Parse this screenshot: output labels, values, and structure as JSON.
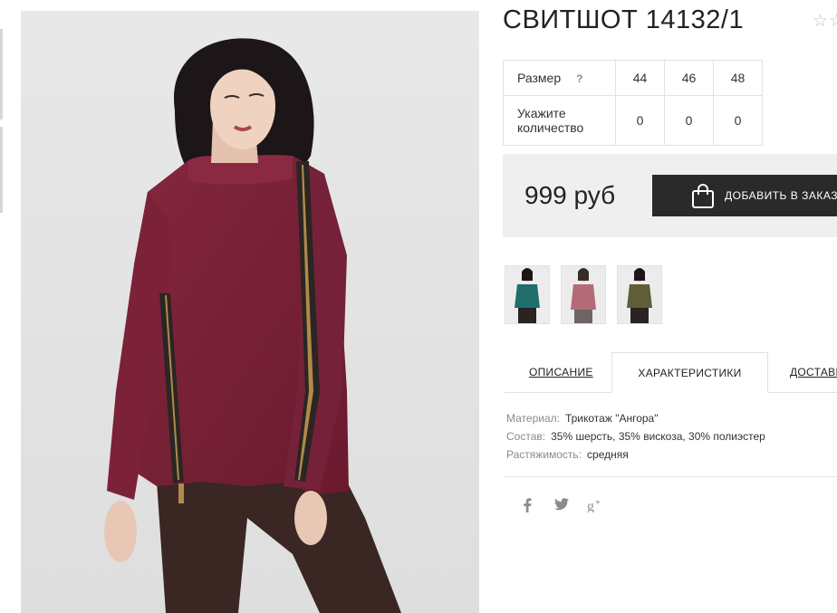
{
  "product": {
    "title": "СВИТШОТ 14132/1",
    "rating_stars": "☆☆"
  },
  "sizes": {
    "size_label": "Размер",
    "help_icon": "?",
    "quantity_label": "Укажите количество",
    "columns": [
      "44",
      "46",
      "48"
    ],
    "quantities": [
      "0",
      "0",
      "0"
    ]
  },
  "purchase": {
    "price": "999 руб",
    "add_to_cart_label": "ДОБАВИТЬ В ЗАКАЗ"
  },
  "variants": [
    {
      "color": "#1f6e6b",
      "name": "teal"
    },
    {
      "color": "#b36b78",
      "name": "dusty-rose"
    },
    {
      "color": "#5f5e36",
      "name": "olive"
    }
  ],
  "tabs": {
    "description": "ОПИСАНИЕ",
    "characteristics": "ХАРАКТЕРИСТИКИ",
    "delivery": "ДОСТАВК"
  },
  "characteristics": [
    {
      "label": "Материал:",
      "value": "Трикотаж \"Ангора\""
    },
    {
      "label": "Состав:",
      "value": "35% шерсть, 35% вискоза, 30% полиэстер"
    },
    {
      "label": "Растяжимость:",
      "value": "средняя"
    }
  ],
  "social": [
    "facebook-icon",
    "twitter-icon",
    "google-plus-icon"
  ],
  "colors": {
    "accent_dark": "#2a2a2a",
    "sweater": "#7a2036",
    "price_bar_bg": "#efefef"
  }
}
